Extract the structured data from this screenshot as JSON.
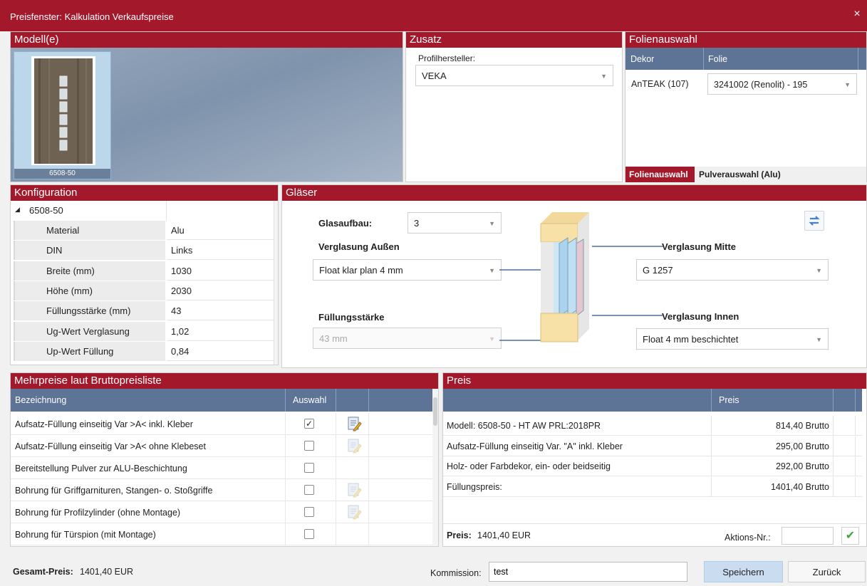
{
  "window": {
    "title": "Preisfenster: Kalkulation Verkaufspreise",
    "close_glyph": "×"
  },
  "modelle": {
    "header": "Modell(e)",
    "selected_caption": "6508-50"
  },
  "zusatz": {
    "header": "Zusatz",
    "label": "Profilhersteller:",
    "value": "VEKA"
  },
  "folien": {
    "header": "Folienauswahl",
    "col_dekor": "Dekor",
    "col_folie": "Folie",
    "row_dekor": "AnTEAK (107)",
    "row_folie": "3241002 (Renolit) - 195",
    "tab_active": "Folienauswahl",
    "tab_other": "Pulverauswahl (Alu)"
  },
  "konfiguration": {
    "header": "Konfiguration",
    "root": "6508-50",
    "rows": [
      {
        "label": "Material",
        "value": "Alu"
      },
      {
        "label": "DIN",
        "value": "Links"
      },
      {
        "label": "Breite (mm)",
        "value": "1030"
      },
      {
        "label": "Höhe (mm)",
        "value": "2030"
      },
      {
        "label": "Füllungsstärke (mm)",
        "value": "43"
      },
      {
        "label": "Ug-Wert Verglasung",
        "value": "1,02"
      },
      {
        "label": "Up-Wert Füllung",
        "value": "0,84"
      }
    ]
  },
  "glaeser": {
    "header": "Gläser",
    "glasaufbau_label": "Glasaufbau:",
    "glasaufbau_value": "3",
    "aussen_label": "Verglasung Außen",
    "aussen_value": "Float klar plan 4 mm",
    "fuellung_label": "Füllungsstärke",
    "fuellung_value": "43 mm",
    "mitte_label": "Verglasung Mitte",
    "mitte_value": "G 1257",
    "innen_label": "Verglasung Innen",
    "innen_value": "Float 4 mm beschichtet"
  },
  "mehrpreise": {
    "header": "Mehrpreise laut Bruttopreisliste",
    "col_bezeichnung": "Bezeichnung",
    "col_auswahl": "Auswahl",
    "rows": [
      {
        "name": "Aufsatz-Füllung einseitig Var >A< inkl. Kleber",
        "checked": true,
        "edit": "active"
      },
      {
        "name": "Aufsatz-Füllung einseitig Var >A< ohne Klebeset",
        "checked": false,
        "edit": "faded"
      },
      {
        "name": "Bereitstellung Pulver zur ALU-Beschichtung",
        "checked": false,
        "edit": "none"
      },
      {
        "name": "Bohrung für Griffgarnituren, Stangen- o. Stoßgriffe",
        "checked": false,
        "edit": "faded"
      },
      {
        "name": "Bohrung für Profilzylinder (ohne Montage)",
        "checked": false,
        "edit": "faded"
      },
      {
        "name": "Bohrung für Türspion (mit Montage)",
        "checked": false,
        "edit": "none"
      }
    ],
    "checkmark": "✓"
  },
  "preis": {
    "header": "Preis",
    "col_preis": "Preis",
    "rows": [
      {
        "name": "Modell: 6508-50 - HT AW PRL:2018PR",
        "value": "814,40 Brutto"
      },
      {
        "name": "Aufsatz-Füllung einseitig Var. \"A\" inkl. Kleber",
        "value": "295,00 Brutto"
      },
      {
        "name": "Holz- oder Farbdekor, ein- oder beidseitig",
        "value": "292,00 Brutto"
      },
      {
        "name": "Füllungspreis:",
        "value": "1401,40 Brutto"
      }
    ],
    "total_label": "Preis:",
    "total_value": "1401,40 EUR",
    "aktion_label": "Aktions-Nr.:",
    "aktion_value": "",
    "confirm_glyph": "✔"
  },
  "footer": {
    "gesamt_label": "Gesamt-Preis:",
    "gesamt_value": "1401,40 EUR",
    "kommission_label": "Kommission:",
    "kommission_value": "test",
    "save_label": "Speichern",
    "back_label": "Zurück"
  },
  "colors": {
    "accent": "#a3192b",
    "grid_header": "#5d7496",
    "save_button": "#c9dcf0"
  }
}
